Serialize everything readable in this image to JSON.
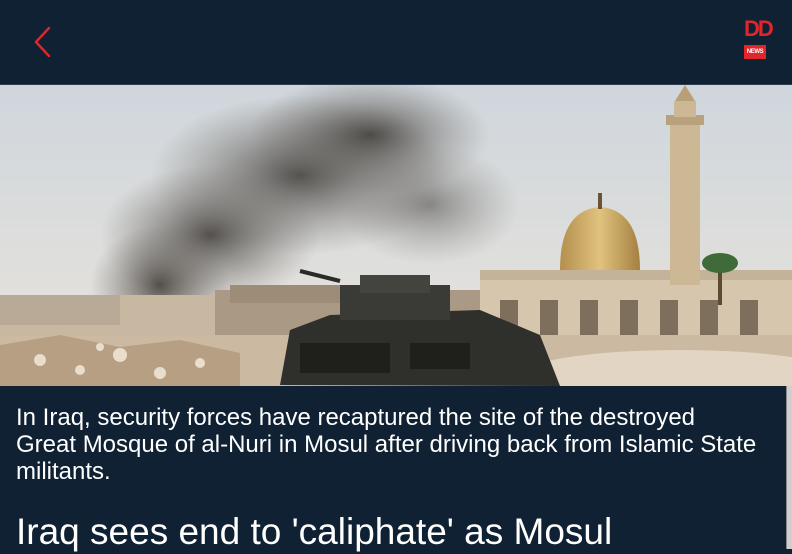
{
  "header": {
    "back_icon": "chevron-left-icon",
    "logo_top": "DD",
    "logo_bottom": "NEWS",
    "accent_color": "#e0262b"
  },
  "article": {
    "image_description_icon": "news-photo",
    "summary": "In Iraq, security forces have recaptured the site of the destroyed Great Mosque of al-Nuri in Mosul after driving back from Islamic State militants.",
    "headline": "Iraq sees end to 'caliphate' as Mosul"
  }
}
